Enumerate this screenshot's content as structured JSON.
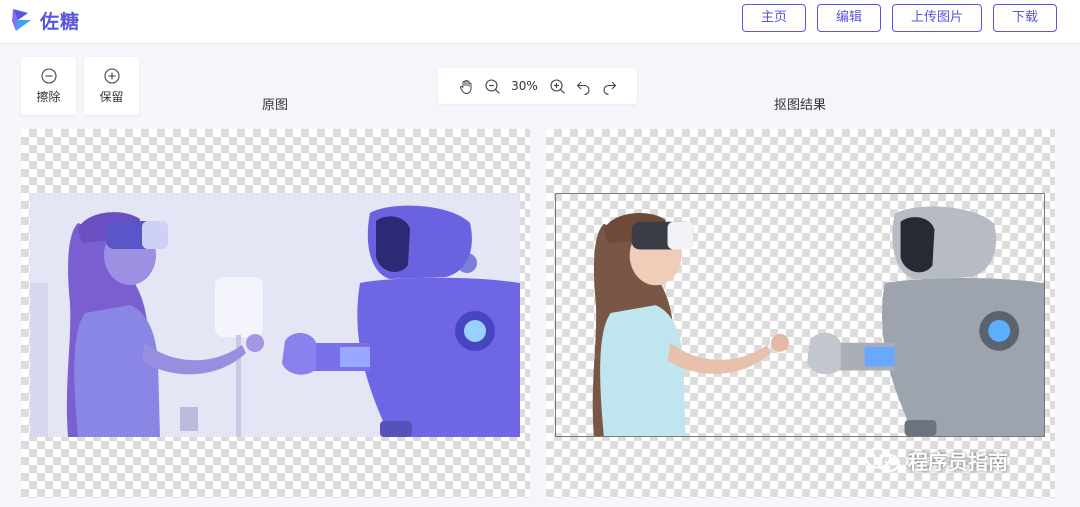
{
  "app": {
    "logo_text": "佐糖"
  },
  "nav": [
    {
      "label": "主页"
    },
    {
      "label": "编辑"
    },
    {
      "label": "上传图片"
    },
    {
      "label": "下载"
    }
  ],
  "tools": {
    "erase_label": "擦除",
    "keep_label": "保留"
  },
  "zoom": {
    "value": "30%"
  },
  "panels": {
    "original_title": "原图",
    "result_title": "抠图结果"
  },
  "watermark": {
    "text": "程序员指南"
  },
  "colors": {
    "accent": "#5a55e0",
    "checker": "#dcdcdc",
    "panel_bg": "#f4f6fb"
  }
}
